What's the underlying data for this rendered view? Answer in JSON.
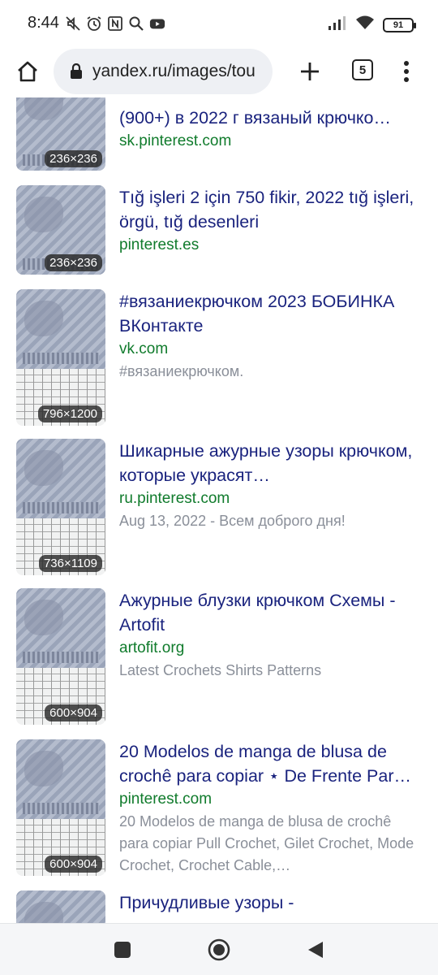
{
  "status_bar": {
    "time": "8:44",
    "battery": "91",
    "icons_left": [
      "mute-icon",
      "alarm-icon",
      "nfc-icon",
      "search-icon",
      "youtube-icon"
    ],
    "icons_right": [
      "signal-icon",
      "wifi-icon",
      "battery-icon"
    ]
  },
  "toolbar": {
    "url": "yandex.ru/images/tou",
    "tab_count": "5",
    "icons": [
      "home-icon",
      "lock-icon",
      "plus-icon",
      "tabs-icon",
      "more-vert-icon"
    ]
  },
  "results": [
    {
      "title": "(900+) в 2022 г вязаный крючко…",
      "source": "sk.pinterest.com",
      "snippet": "",
      "size": "236×236"
    },
    {
      "title": "Tığ işleri 2 için 750 fikir, 2022 tığ işleri, örgü, tığ desenleri",
      "source": "pinterest.es",
      "snippet": "",
      "size": "236×236"
    },
    {
      "title": "#вязаниекрючком 2023 БОБИНКА ВКонтакте",
      "source": "vk.com",
      "snippet": "#вязаниекрючком.",
      "size": "796×1200"
    },
    {
      "title": "Шикарные ажурные узоры крючком, которые украсят…",
      "source": "ru.pinterest.com",
      "snippet": "Aug 13, 2022 - Всем доброго дня!",
      "size": "736×1109"
    },
    {
      "title": "Ажурные блузки крючком Схемы - Artofit",
      "source": "artofit.org",
      "snippet": "Latest Crochets Shirts Patterns",
      "size": "600×904"
    },
    {
      "title": "20 Modelos de manga de blusa de crochê para copiar ⋆ De Frente Par…",
      "source": "pinterest.com",
      "snippet": "20 Modelos de manga de blusa de crochê para copiar Pull Crochet, Gilet Crochet, Mode Crochet, Crochet Cable,…",
      "size": "600×904"
    },
    {
      "title": "Причудливые узоры -",
      "source": "",
      "snippet": "",
      "size": ""
    }
  ],
  "nav_bar": {
    "icons": [
      "recents-square-icon",
      "home-circle-icon",
      "back-triangle-icon"
    ]
  }
}
